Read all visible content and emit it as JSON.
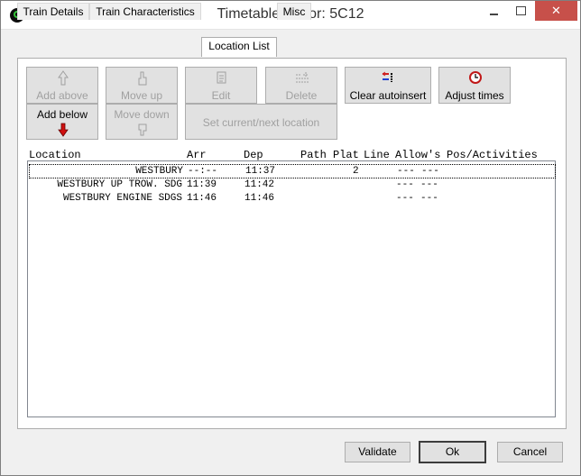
{
  "window": {
    "title": "Timetable Editor: 5C12"
  },
  "tabs": [
    {
      "label": "Train Details"
    },
    {
      "label": "Train Characteristics"
    },
    {
      "label": "Location List"
    },
    {
      "label": "Misc"
    }
  ],
  "toolbar": {
    "add_above": "Add above",
    "move_up": "Move up",
    "edit": "Edit",
    "delete": "Delete",
    "clear_autoinsert": "Clear autoinsert",
    "adjust_times": "Adjust times",
    "add_below": "Add below",
    "move_down": "Move down",
    "set_current_next": "Set current/next location"
  },
  "list": {
    "headers": {
      "location": "Location",
      "arr": "Arr",
      "dep": "Dep",
      "path": "Path",
      "plat": "Plat",
      "line": "Line",
      "allows": "Allow's",
      "activities": "Pos/Activities"
    },
    "rows": [
      {
        "location": "WESTBURY",
        "arr": "--:--",
        "dep": "11:37",
        "plat": "2",
        "allow1": "---",
        "allow2": "---"
      },
      {
        "location": "WESTBURY UP TROW. SDG",
        "arr": "11:39",
        "dep": "11:42",
        "plat": "",
        "allow1": "---",
        "allow2": "---"
      },
      {
        "location": "WESTBURY ENGINE SDGS",
        "arr": "11:46",
        "dep": "11:46",
        "plat": "",
        "allow1": "---",
        "allow2": "---"
      }
    ]
  },
  "footer": {
    "validate": "Validate",
    "ok": "Ok",
    "cancel": "Cancel"
  }
}
